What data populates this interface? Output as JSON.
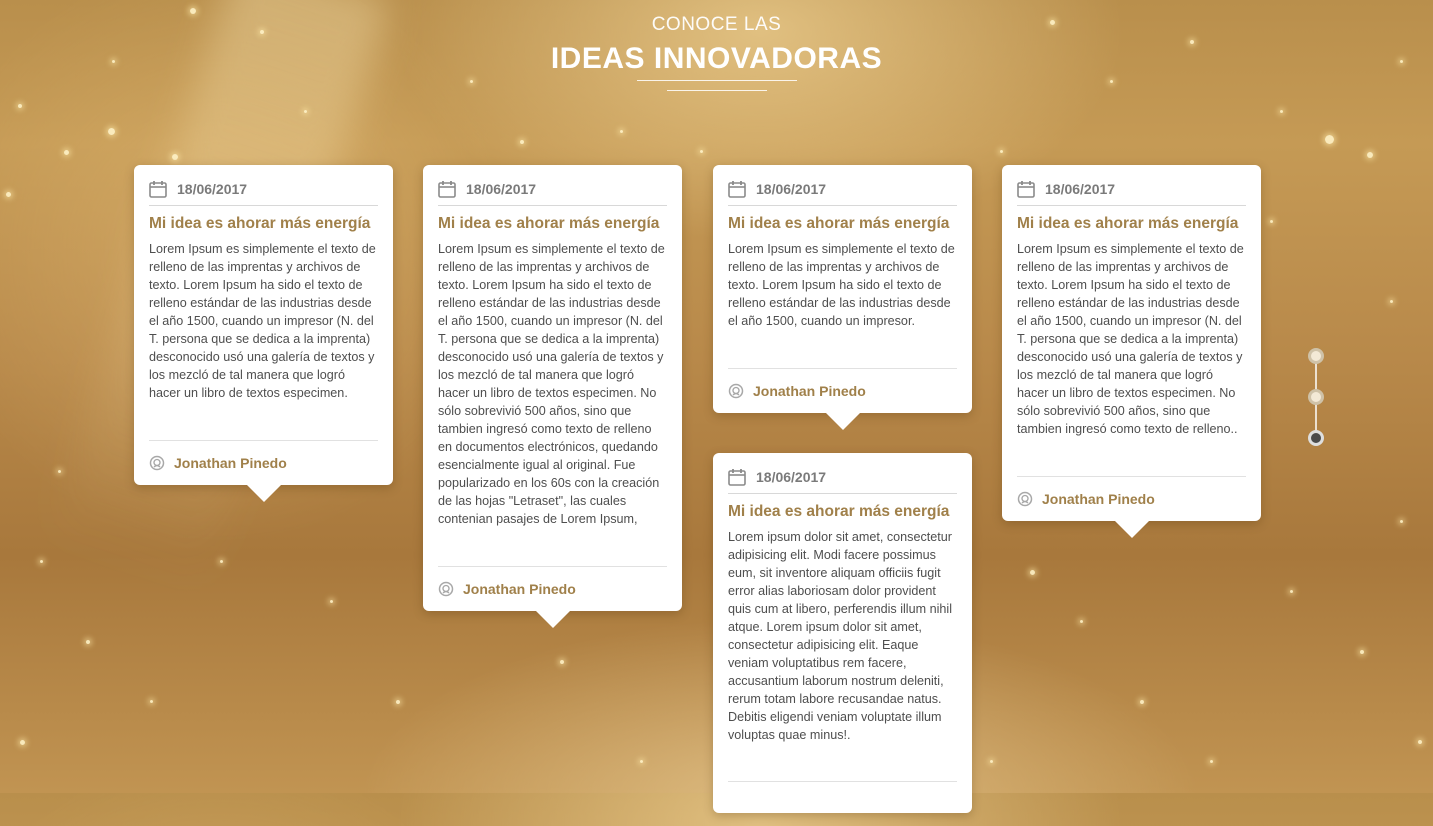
{
  "header": {
    "kicker": "CONOCE LAS",
    "title": "IDEAS INNOVADORAS"
  },
  "colors": {
    "accent": "#a0804a",
    "background_gold": "#b98f4c",
    "card": "#ffffff",
    "body_text": "#4e4e4e",
    "date_text": "#7a7a7a"
  },
  "icons": {
    "date": "calendar-icon",
    "author": "author-icon"
  },
  "cards": [
    {
      "date": "18/06/2017",
      "title": "Mi idea es ahorar más energía",
      "body": "Lorem Ipsum es simplemente el texto de relleno de las imprentas y archivos de texto. Lorem Ipsum ha sido el texto de relleno estándar de las industrias desde el año 1500, cuando un impresor (N. del T. persona que se dedica a la imprenta) desconocido usó una galería de textos y los mezcló de tal manera que logró hacer un libro de textos especimen.",
      "author": "Jonathan Pinedo"
    },
    {
      "date": "18/06/2017",
      "title": "Mi idea es ahorar más energía",
      "body": "Lorem Ipsum es simplemente el texto de relleno de las imprentas y archivos de texto. Lorem Ipsum ha sido el texto de relleno estándar de las industrias desde el año 1500, cuando un impresor (N. del T. persona que se dedica a la imprenta) desconocido usó una galería de textos y los mezcló de tal manera que logró hacer un libro de textos especimen. No sólo sobrevivió 500 años, sino que tambien ingresó como texto de relleno en documentos electrónicos, quedando esencialmente igual al original. Fue popularizado en los 60s con la creación de las hojas \"Letraset\", las cuales contenian pasajes de Lorem Ipsum,",
      "author": "Jonathan Pinedo"
    },
    {
      "date": "18/06/2017",
      "title": "Mi idea es ahorar más energía",
      "body": "Lorem Ipsum es simplemente el texto de relleno de las imprentas y archivos de texto. Lorem Ipsum ha sido el texto de relleno estándar de las industrias desde el año 1500, cuando un impresor.",
      "author": "Jonathan Pinedo"
    },
    {
      "date": "18/06/2017",
      "title": "Mi idea es ahorar más energía",
      "body": "Lorem ipsum dolor sit amet, consectetur adipisicing elit. Modi facere possimus eum, sit inventore aliquam officiis fugit error alias laboriosam dolor provident quis cum at libero, perferendis illum nihil atque. Lorem ipsum dolor sit amet, consectetur adipisicing elit. Eaque veniam voluptatibus rem facere, accusantium laborum nostrum deleniti, rerum totam labore recusandae natus. Debitis eligendi veniam voluptate illum voluptas quae minus!.",
      "author": ""
    },
    {
      "date": "18/06/2017",
      "title": "Mi idea es ahorar más energía",
      "body": "Lorem Ipsum es simplemente el texto de relleno de las imprentas y archivos de texto. Lorem Ipsum ha sido el texto de relleno estándar de las industrias desde el año 1500, cuando un impresor (N. del T. persona que se dedica a la imprenta) desconocido usó una galería de textos y los mezcló de tal manera que logró hacer un libro de textos especimen. No sólo sobrevivió 500 años, sino que tambien ingresó como texto de relleno..",
      "author": "Jonathan Pinedo"
    }
  ],
  "pager": {
    "pages": 3,
    "active_index": 2
  }
}
